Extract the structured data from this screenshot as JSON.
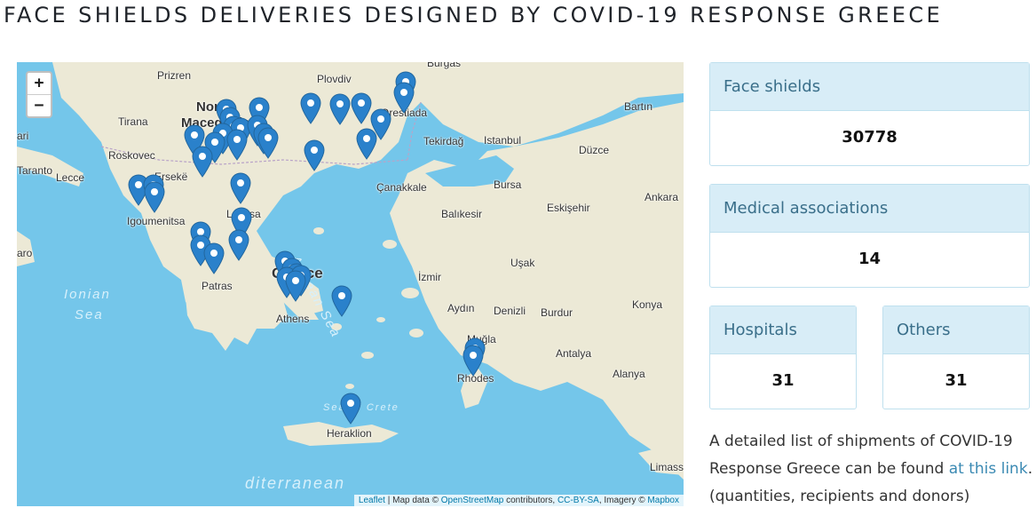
{
  "title": "FACE SHIELDS DELIVERIES DESIGNED BY COVID-19 RESPONSE GREECE",
  "map": {
    "zoom_in": "+",
    "zoom_out": "−",
    "attribution": {
      "leaflet": "Leaflet",
      "sep1": " | Map data © ",
      "osm": "OpenStreetMap",
      "sep2": " contributors, ",
      "license": "CC-BY-SA",
      "sep3": ", Imagery © ",
      "mapbox": "Mapbox"
    },
    "labels": {
      "burgas": "Burgas",
      "prizren": "Prizren",
      "plovdiv": "Plovdiv",
      "north": "North",
      "macedonia": "Macedonia",
      "tirana": "Tirana",
      "bari": "ari",
      "roskovec": "Roskovec",
      "erseke": "Ersekë",
      "taranto": "Taranto",
      "lecce": "Lecce",
      "igoumenitsa": "Igoumenitsa",
      "larissa": "Larissa",
      "greece": "Greece",
      "athens": "Athens",
      "patras": "Patras",
      "crotone": "aro",
      "ionian1": "Ionian",
      "ionian2": "Sea",
      "aegean": "Aegean Sea",
      "sea_of_crete": "Sea of Crete",
      "mediterranean": "diterranean",
      "heraklion": "Heraklion",
      "rhodes": "Rhodes",
      "edirne": "Orestiada",
      "tekirdag": "Tekirdağ",
      "istanbul": "Istanbul",
      "bartin": "Bartın",
      "duzce": "Düzce",
      "bursa": "Bursa",
      "canakkale": "Çanakkale",
      "balikesir": "Balıkesir",
      "eskisehir": "Eskişehir",
      "ankara": "Ankara",
      "usak": "Uşak",
      "izmir": "İzmir",
      "aydin": "Aydın",
      "denizli": "Denizli",
      "burdur": "Burdur",
      "konya": "Konya",
      "mugla": "Muğla",
      "antalya": "Antalya",
      "alanya": "Alanya",
      "limassol": "Limass"
    }
  },
  "stats": {
    "face_shields": {
      "label": "Face shields",
      "value": "30778"
    },
    "medical": {
      "label": "Medical associations",
      "value": "14"
    },
    "hospitals": {
      "label": "Hospitals",
      "value": "31"
    },
    "others": {
      "label": "Others",
      "value": "31"
    }
  },
  "description": {
    "text": "A detailed list of shipments of COVID-19 Response Greece can be found ",
    "link": "at this link",
    "after": ".",
    "note": "(quantities, recipients and donors)"
  },
  "colors": {
    "marker": "#2a81cb",
    "sea": "#74c6ea",
    "land": "#ece9d6",
    "card_head": "#d8edf7"
  }
}
